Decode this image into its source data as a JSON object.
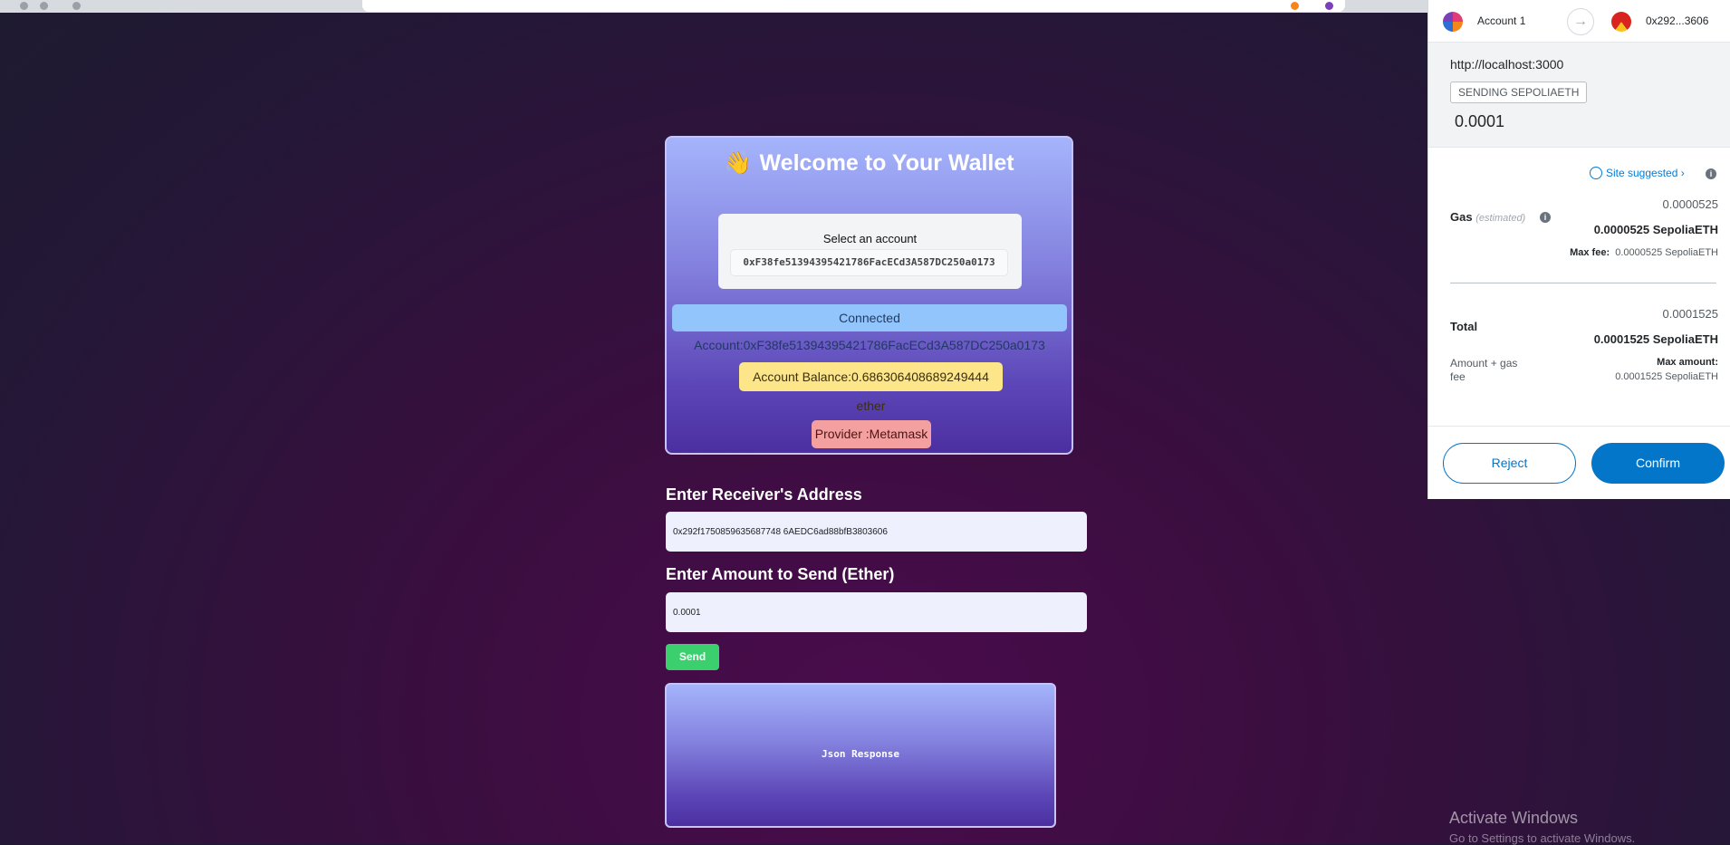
{
  "wallet": {
    "title": "Welcome to Your Wallet",
    "title_icon": "waving-hand-icon",
    "select_label": "Select an account",
    "selected_account": "0xF38fe51394395421786FacECd3A587DC250a0173",
    "connected_account": "Connected Account:0xF38fe51394395421786FacECd3A587DC250a0173",
    "account_balance": "Account Balance:0.686306408689249444 ether",
    "provider": "Provider :Metamask"
  },
  "form": {
    "receiver_label": "Enter Receiver's Address",
    "receiver_value": "0x292f1750859635687748 6AEDC6ad88bfB3803606",
    "amount_label": "Enter Amount to Send (Ether)",
    "amount_value": "0.0001",
    "send_label": "Send",
    "json_response": "Json Response"
  },
  "metamask": {
    "from_account": "Account 1",
    "to_account": "0x292...3606",
    "origin": "http://localhost:3000",
    "action_pill": "SENDING SEPOLIAETH",
    "amount": "0.0001",
    "site_suggested": "Site suggested",
    "gas_label": "Gas",
    "gas_estimated": "(estimated)",
    "gas_value_small": "0.0000525",
    "gas_value_bold": "0.0000525 SepoliaETH",
    "max_fee_label": "Max fee:",
    "max_fee_value": "0.0000525 SepoliaETH",
    "total_label": "Total",
    "total_value_small": "0.0001525",
    "total_value_bold": "0.0001525 SepoliaETH",
    "amount_gas_label": "Amount + gas fee",
    "max_amount_label": "Max amount:",
    "max_amount_value": "0.0001525 SepoliaETH",
    "reject_label": "Reject",
    "confirm_label": "Confirm"
  },
  "os": {
    "activate_title": "Activate Windows",
    "activate_sub": "Go to Settings to activate Windows."
  },
  "colors": {
    "connected_bg": "#93c5fd",
    "balance_bg": "#fde68a",
    "provider_bg": "#f5a0a0",
    "send_bg": "#3ccf6e",
    "metamask_blue": "#0376c9"
  }
}
